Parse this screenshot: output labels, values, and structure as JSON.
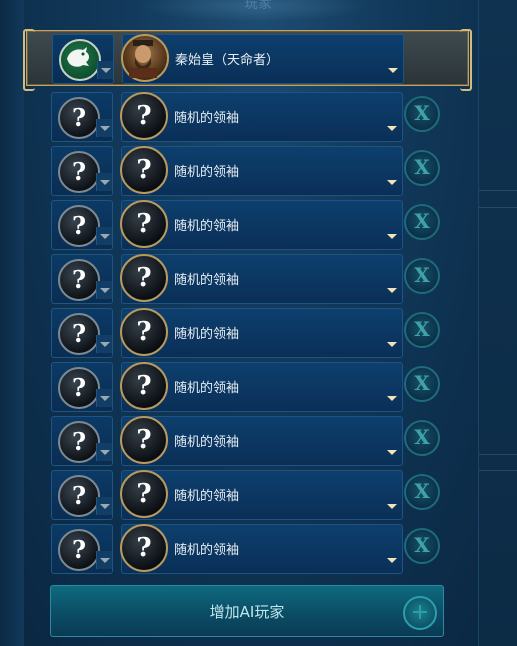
{
  "header": {
    "title_fragment": "玩家"
  },
  "human_player": {
    "civ_icon": "dragon-emblem-icon",
    "leader_icon": "qin-shi-huang-portrait",
    "leader_name": "秦始皇（天命者）"
  },
  "ai_players": [
    {
      "civ_icon": "question-mark-icon",
      "leader_icon": "question-mark-icon",
      "leader_name": "随机的领袖",
      "remove_glyph": "X"
    },
    {
      "civ_icon": "question-mark-icon",
      "leader_icon": "question-mark-icon",
      "leader_name": "随机的领袖",
      "remove_glyph": "X"
    },
    {
      "civ_icon": "question-mark-icon",
      "leader_icon": "question-mark-icon",
      "leader_name": "随机的领袖",
      "remove_glyph": "X"
    },
    {
      "civ_icon": "question-mark-icon",
      "leader_icon": "question-mark-icon",
      "leader_name": "随机的领袖",
      "remove_glyph": "X"
    },
    {
      "civ_icon": "question-mark-icon",
      "leader_icon": "question-mark-icon",
      "leader_name": "随机的领袖",
      "remove_glyph": "X"
    },
    {
      "civ_icon": "question-mark-icon",
      "leader_icon": "question-mark-icon",
      "leader_name": "随机的领袖",
      "remove_glyph": "X"
    },
    {
      "civ_icon": "question-mark-icon",
      "leader_icon": "question-mark-icon",
      "leader_name": "随机的领袖",
      "remove_glyph": "X"
    },
    {
      "civ_icon": "question-mark-icon",
      "leader_icon": "question-mark-icon",
      "leader_name": "随机的领袖",
      "remove_glyph": "X"
    },
    {
      "civ_icon": "question-mark-icon",
      "leader_icon": "question-mark-icon",
      "leader_name": "随机的领袖",
      "remove_glyph": "X"
    }
  ],
  "question_glyph": "?",
  "add_ai_button": {
    "label": "增加AI玩家",
    "icon": "plus-icon",
    "glyph": "+"
  }
}
